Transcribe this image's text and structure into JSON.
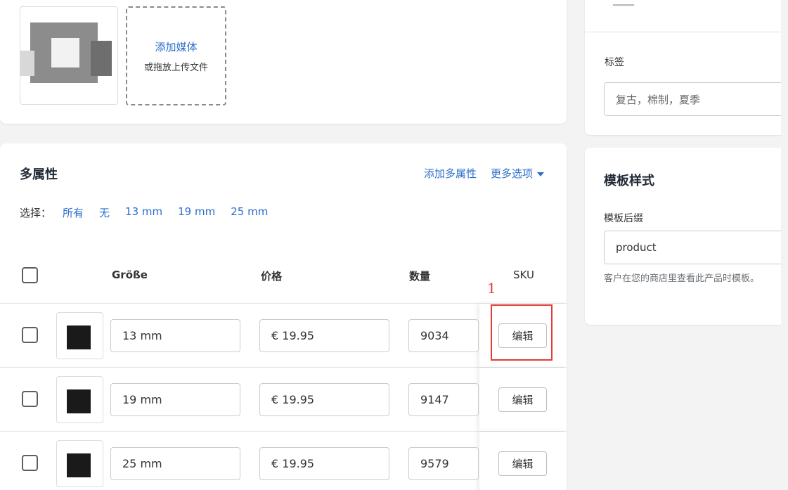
{
  "media": {
    "add_media": "添加媒体",
    "drop_hint": "或拖放上传文件"
  },
  "variants": {
    "title": "多属性",
    "add_variant": "添加多属性",
    "more_options": "更多选项",
    "select_label": "选择：",
    "select_options": [
      "所有",
      "无",
      "13 mm",
      "19 mm",
      "25 mm"
    ],
    "columns": {
      "size": "Größe",
      "price": "价格",
      "quantity": "数量",
      "sku": "SKU"
    },
    "rows": [
      {
        "size": "13 mm",
        "price": "€  19.95",
        "quantity": "9034",
        "edit": "编辑"
      },
      {
        "size": "19 mm",
        "price": "€  19.95",
        "quantity": "9147",
        "edit": "编辑"
      },
      {
        "size": "25 mm",
        "price": "€  19.95",
        "quantity": "9579",
        "edit": "编辑"
      }
    ]
  },
  "annotation": {
    "marker": "1"
  },
  "tags": {
    "label": "标签",
    "value": "复古，棉制，夏季"
  },
  "template": {
    "title": "模板样式",
    "suffix_label": "模板后缀",
    "suffix_value": "product",
    "help": "客户在您的商店里查看此产品时模板。"
  },
  "colors": {
    "link": "#2c6ecb",
    "highlight": "#e53935"
  }
}
